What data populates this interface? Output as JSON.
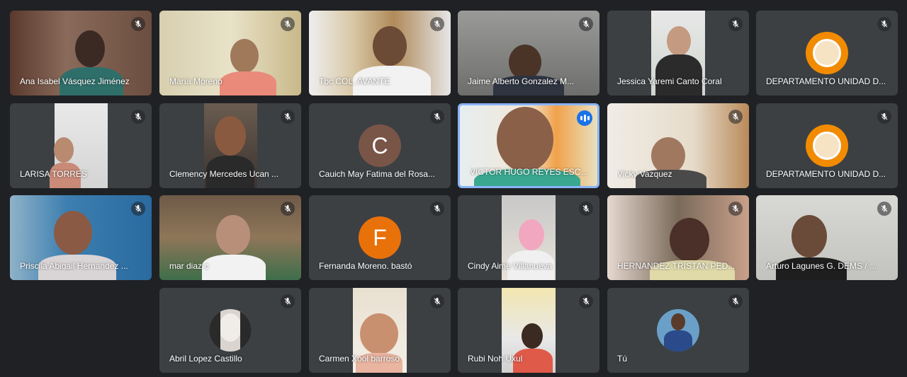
{
  "participants": [
    {
      "name": "Ana Isabel Vásquez Jiménez"
    },
    {
      "name": "María Moreno"
    },
    {
      "name": "Tbc COL. AVANTE"
    },
    {
      "name": "Jaime Alberto Gonzalez M..."
    },
    {
      "name": "Jessica Yaremi Canto Coral"
    },
    {
      "name": "DEPARTAMENTO UNIDAD D..."
    },
    {
      "name": "LARISA TORRES"
    },
    {
      "name": "Clemency Mercedes Ucan ..."
    },
    {
      "name": "Cauich May Fatima del Rosa...",
      "initial": "C"
    },
    {
      "name": "VICTOR HUGO REYES ESC..."
    },
    {
      "name": "Vicky Vazquez"
    },
    {
      "name": "DEPARTAMENTO UNIDAD D..."
    },
    {
      "name": "Priscila Abigail Hernandez ..."
    },
    {
      "name": "mar diaz c"
    },
    {
      "name": "Fernanda Moreno. bastó",
      "initial": "F"
    },
    {
      "name": "Cindy Aime Villanueva"
    },
    {
      "name": "HERNANDEZ TRISTAN PED..."
    },
    {
      "name": "Arturo Lagunes G. DEMS / ..."
    },
    {
      "name": "Abril Lopez Castillo"
    },
    {
      "name": "Carmen Xool barroso"
    },
    {
      "name": "Rubi Noh Uxul"
    },
    {
      "name": "Tú"
    }
  ],
  "colors": {
    "background": "#202124",
    "tile": "#3c4043",
    "speaking": "#8ab4f8",
    "avatar_c": "#795548",
    "avatar_f": "#e8710a"
  }
}
